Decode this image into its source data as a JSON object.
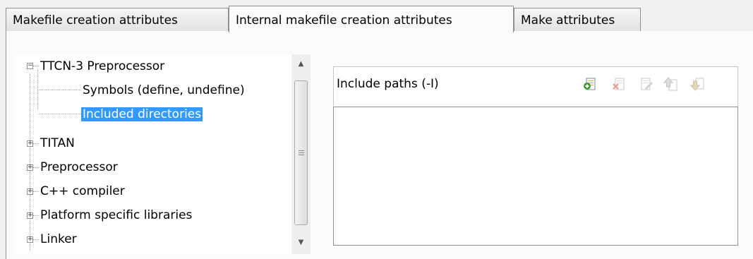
{
  "tabs": [
    {
      "label": "Makefile creation attributes"
    },
    {
      "label": "Internal makefile creation attributes"
    },
    {
      "label": "Make attributes"
    }
  ],
  "tree": {
    "items": [
      {
        "label": "TTCN-3 Preprocessor",
        "expander": "−"
      },
      {
        "label": "Symbols (define, undefine)"
      },
      {
        "label": "Included directories"
      },
      {
        "label": "TITAN",
        "expander": "+"
      },
      {
        "label": "Preprocessor",
        "expander": "+"
      },
      {
        "label": "C++ compiler",
        "expander": "+"
      },
      {
        "label": "Platform specific libraries",
        "expander": "+"
      },
      {
        "label": "Linker",
        "expander": "+"
      }
    ]
  },
  "scrollbar": {
    "up": "▲",
    "down": "▼"
  },
  "panel": {
    "title": "Include paths (-I)",
    "tools": [
      "add-icon",
      "delete-icon",
      "edit-icon",
      "move-up-icon",
      "move-down-icon"
    ]
  }
}
